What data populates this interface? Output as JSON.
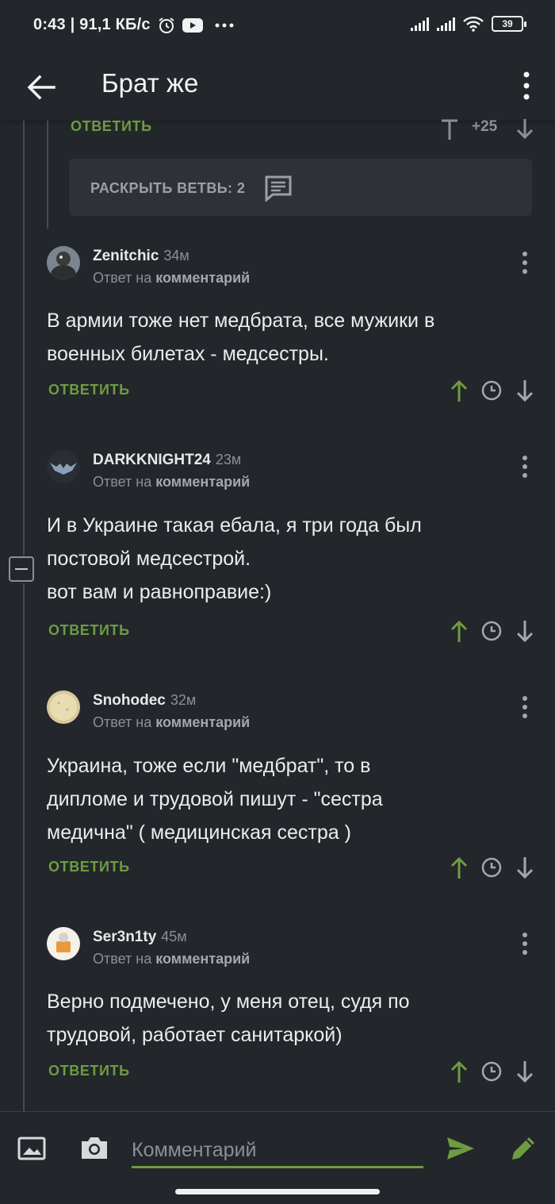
{
  "status_bar": {
    "text": "0:43 | 91,1 КБ/с",
    "battery": "39",
    "icons": [
      "alarm-icon",
      "youtube-icon",
      "more-dots-icon",
      "signal-icon",
      "signal-icon",
      "wifi-icon",
      "battery-icon"
    ]
  },
  "app_bar": {
    "title": "Брат же",
    "back_icon": "arrow-left-icon",
    "menu_icon": "more-vertical-icon"
  },
  "previous_comment": {
    "reply_label": "ОТВЕТИТЬ",
    "rating": "+25"
  },
  "expand_branch": {
    "label": "РАСКРЫТЬ ВЕТВЬ: 2",
    "icon": "comment-icon"
  },
  "comments": [
    {
      "username": "Zenitchic",
      "time": "34м",
      "reply_prefix": "Ответ на",
      "reply_target": "комментарий",
      "lines": [
        "В армии тоже нет медбрата, все мужики в",
        "военных билетах - медсестры."
      ],
      "reply_label": "ОТВЕТИТЬ"
    },
    {
      "username": "DARKKNIGHT24",
      "time": "23м",
      "reply_prefix": "Ответ на",
      "reply_target": "комментарий",
      "lines": [
        "И в Украине такая ебала, я три года был",
        "постовой медсестрой.",
        "вот вам и равноправие:)"
      ],
      "reply_label": "ОТВЕТИТЬ"
    },
    {
      "username": "Snohodec",
      "time": "32м",
      "reply_prefix": "Ответ на",
      "reply_target": "комментарий",
      "lines": [
        "Украина, тоже если \"медбрат\", то в",
        "дипломе и трудовой пишут - \"сестра",
        "медична\" ( медицинская сестра )"
      ],
      "reply_label": "ОТВЕТИТЬ"
    },
    {
      "username": "Ser3n1ty",
      "time": "45м",
      "reply_prefix": "Ответ на",
      "reply_target": "комментарий",
      "lines": [
        "Верно подмечено, у меня отец, судя по",
        "трудовой, работает санитаркой)"
      ],
      "reply_label": "ОТВЕТИТЬ"
    }
  ],
  "bottom_bar": {
    "placeholder": "Комментарий",
    "icons": [
      "image-icon",
      "camera-icon",
      "send-icon",
      "pencil-icon"
    ]
  },
  "colors": {
    "background": "#23262b",
    "accent_green": "#6d9c41",
    "muted_text": "#8b9096",
    "panel": "#2e3237"
  }
}
